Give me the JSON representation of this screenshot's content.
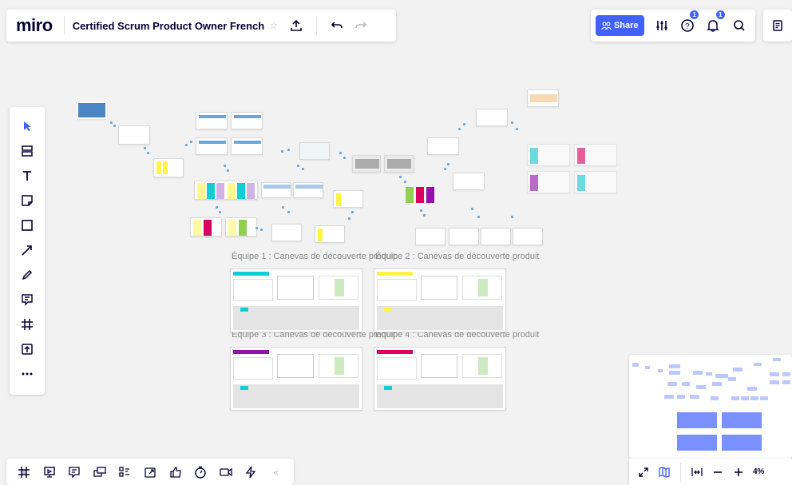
{
  "app": {
    "logo": "miro",
    "board_title": "Certified Scrum Product Owner French"
  },
  "header": {
    "share_label": "Share",
    "help_badge": "1",
    "notifications_badge": "1"
  },
  "canvas": {
    "frame_labels": [
      "Équipe 1 : Canevas de découverte produit",
      "Équipe 2 : Canevas de découverte produit",
      "Équipe 3 : Canevas de découverte produit",
      "Équipe 4 : Canevas de découverte produit"
    ]
  },
  "left_toolbar": {
    "tools": [
      "select-icon",
      "templates-icon",
      "text-icon",
      "sticky-note-icon",
      "shape-icon",
      "arrow-icon",
      "pen-icon",
      "comment-icon",
      "frame-icon",
      "upload-icon",
      "more-icon"
    ]
  },
  "bottom_toolbar": {
    "tools": [
      "frames-icon",
      "presentation-icon",
      "comments-icon",
      "cards-icon",
      "kanban-icon",
      "export-icon",
      "voting-icon",
      "timer-icon",
      "video-icon",
      "activity-icon"
    ]
  },
  "zoom": {
    "level": "4%"
  },
  "colors": {
    "accent": "#4262ff",
    "teal": "#12cdd4",
    "yellow": "#fef445",
    "pink": "#f24726",
    "magenta": "#da0063",
    "purple": "#9510ac",
    "lightpurple": "#cfb3e7",
    "green": "#8fd14f"
  }
}
